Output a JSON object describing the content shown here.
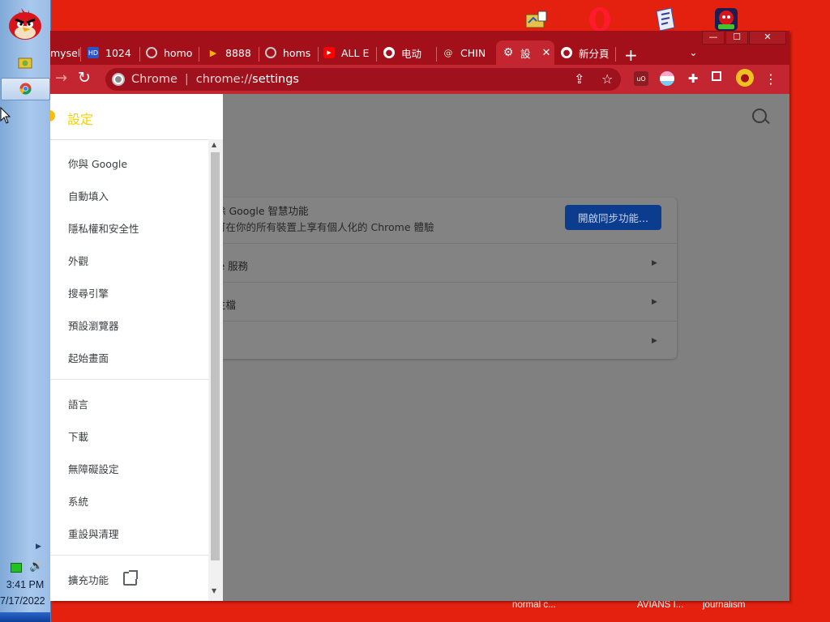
{
  "taskbar": {
    "clock_time": "3:41 PM",
    "clock_date": "7/17/2022"
  },
  "desktop": {
    "labels": [
      "normal c...",
      "AVIANS I...",
      "journalism"
    ]
  },
  "window": {
    "controls": {
      "minimize": "—",
      "maximize": "☐",
      "close": "✕"
    },
    "tabs": [
      {
        "label": "mysel",
        "icon": "generic-favicon"
      },
      {
        "label": "1024",
        "icon": "hd-icon"
      },
      {
        "label": "homo",
        "icon": "globe-icon"
      },
      {
        "label": "8888",
        "icon": "bookmark-icon"
      },
      {
        "label": "homs",
        "icon": "globe-icon"
      },
      {
        "label": "ALL E",
        "icon": "youtube-icon"
      },
      {
        "label": "电动",
        "icon": "globe-icon"
      },
      {
        "label": "CHIN",
        "icon": "spiral-icon"
      },
      {
        "label": "設",
        "icon": "gear-icon",
        "active": true
      },
      {
        "label": "新分頁",
        "icon": "globe-icon"
      }
    ],
    "new_tab": "+",
    "tab_search": "⌄"
  },
  "toolbar": {
    "forward": "→",
    "reload": "↻",
    "site_label": "Chrome",
    "divider": "|",
    "url_prefix": "chrome://",
    "url_rest": "settings",
    "share": "⇪",
    "star": "☆",
    "menu": "⋮"
  },
  "settings": {
    "drawer_title": "設定",
    "nav": [
      "你與 Google",
      "自動填入",
      "隱私權和安全性",
      "外觀",
      "搜尋引擎",
      "預設瀏覽器",
      "起始畫面",
      "語言",
      "下載",
      "無障礙設定",
      "系統",
      "重設與清理"
    ],
    "extensions": "擴充功能",
    "sync_title": "除 Google 智慧功能",
    "sync_desc": "可在你的所有裝置上享有個人化的 Chrome 體驗",
    "sync_button": "開啟同步功能...",
    "row_services": "le 服務",
    "row_profile": "主檔"
  },
  "colors": {
    "desktop": "#e4200f",
    "chrome_frame": "#a4101a",
    "toolbar": "#c32631",
    "sync_button": "#0b3c8e",
    "drawer_title": "#f4d100"
  }
}
